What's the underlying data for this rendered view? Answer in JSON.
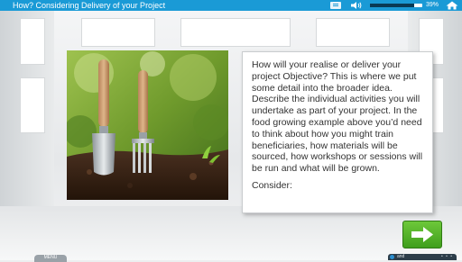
{
  "header": {
    "title": "How? Considering Delivery of your Project",
    "volume_level": 0.85,
    "volume_label": "39%"
  },
  "content": {
    "body_text": "How will your realise or deliver your project Objective? This is where we put some detail into the broader idea. Describe the individual activities you will undertake as part of your project. In the food growing example above you’d need to think about how you might train beneficiaries, how materials will be sourced, how workshops or sessions will be run and what will be grown.",
    "consider_label": "Consider:"
  },
  "footer": {
    "menu_tab_label": "MENU",
    "strip_label": "and",
    "strip_dots": "• • •"
  },
  "icons": {
    "menu": "menu-icon",
    "volume": "speaker-icon",
    "home": "home-icon",
    "next": "arrow-right-icon",
    "info": "info-icon"
  },
  "colors": {
    "topbar": "#1a9ad6",
    "next_button": "#4fae26"
  }
}
